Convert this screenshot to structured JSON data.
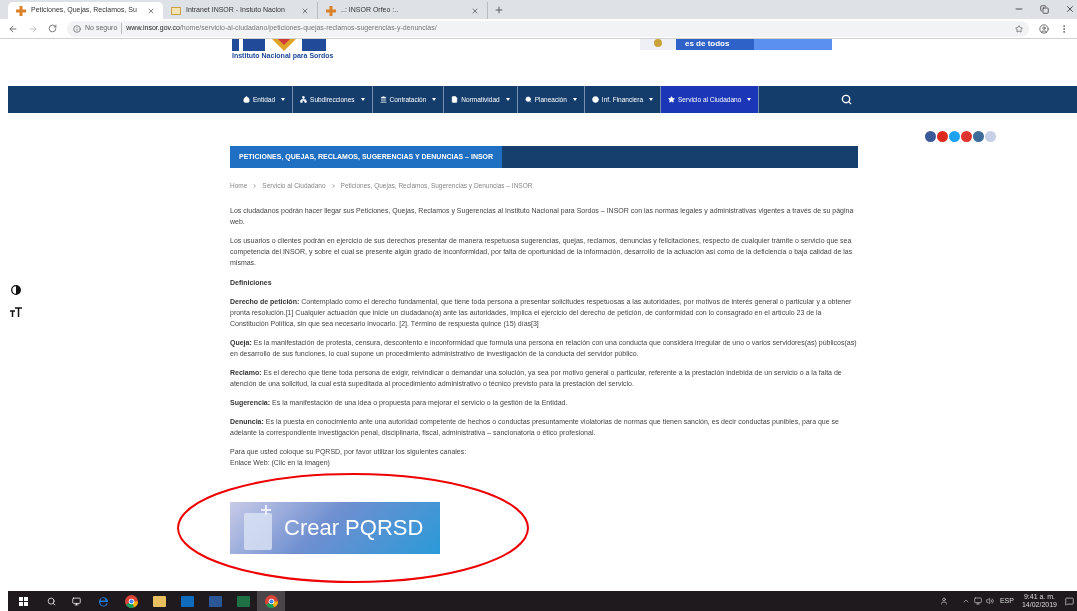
{
  "browser": {
    "tabs": [
      {
        "title": "Peticiones, Quejas, Reclamos, Su",
        "selected": true
      },
      {
        "title": "Intranet INSOR - Instuto Nacion",
        "selected": false
      },
      {
        "title": "..: INSOR Orfeo :..",
        "selected": false
      }
    ],
    "security": "No seguro",
    "url_host": "www.insor.gov.co",
    "url_path": "/home/servicio-al-ciudadano/peticiones-quejas-reclamos-sugerencias-y-denuncias/"
  },
  "header": {
    "logo_subtitle": "Instituto Nacional para Sordos",
    "banner": "es de todos"
  },
  "nav": [
    {
      "label": "Entidad",
      "selected": false
    },
    {
      "label": "Subdirecciones",
      "selected": false
    },
    {
      "label": "Contratación",
      "selected": false
    },
    {
      "label": "Normatividad",
      "selected": false
    },
    {
      "label": "Planeación",
      "selected": false
    },
    {
      "label": "Inf. Financiera",
      "selected": false
    },
    {
      "label": "Servicio al Ciudadano",
      "selected": true
    }
  ],
  "page": {
    "title": "PETICIONES, QUEJAS, RECLAMOS, SUGERENCIAS Y DENUNCIAS – INSOR",
    "breadcrumb": [
      "Home",
      "Servicio al Ciudadano",
      "Peticiones, Quejas, Reclamos, Sugerencias y Denuncias – INSOR"
    ],
    "intro": [
      "Los ciudadanos podrán hacer llegar sus Peticiones, Quejas, Reclamos y Sugerencias al Instituto Nacional para Sordos – INSOR con las normas legales y administrativas vigentes a través de su página web.",
      "Los usuarios o clientes podrán en ejercicio de sus derechos presentar de manera respetuosa sugerencias, quejas, reclamos, denuncias y felicitaciones, respecto de cualquier trámite o servicio que sea competencia del INSOR, y sobre el cual se presente algún grado de inconformidad, por falta de oportunidad de la información, desarrollo de la actuación así como de la deficiencia o baja calidad de las mismas."
    ],
    "definitions_heading": "Definiciones",
    "definitions": [
      "**Derecho de petición:** Contemplado como el derecho fundamental, que tiene toda persona a presentar solicitudes respetuosas a las autoridades, por motivos de interés general o particular y a obtener pronta resolución.[1] Cualquier actuación que inicie un ciudadano(a) ante las autoridades, implica el ejercicio del derecho de petición, de conformidad con lo consagrado en el artículo 23 de la Constitución Política, sin que sea necesario invocarlo. [2]. Término de respuesta quince (15) días[3]",
      "**Queja:** Es la manifestación de protesta, censura, descontento e inconformidad que formula una persona en relación con una conducta que considera irregular de uno o varios servidores(as) públicos(as) en desarrollo de sus funciones, lo cual supone un procedimiento administrativo de investigación de la conducta del servidor público.",
      "**Reclamo:** Es el derecho que tiene toda persona de exigir, reivindicar o demandar una solución, ya sea por motivo general o particular, referente a la prestación indebida de un servicio o a la falta de atención de una solicitud, la cual está supeditada al procedimiento administrativo o técnico previsto para la prestación del servicio.",
      "**Sugerencia:** Es la manifestación de una idea o propuesta para mejorar el servicio o la gestión de la Entidad.",
      "**Denuncia:** Es la puesta en conocimiento ante una autoridad competente de hechos o conductas presuntamente violatorias de normas que tienen sanción, es decir conductas punibles, para que se adelante la correspondiente investigación penal, disciplinaria, fiscal, administrativa – sancionatoria o ético profesional."
    ],
    "channels_lines": [
      "Para que usted coloque su PQRSD, por favor utilizar los siguientes canales:",
      "Enlace Web: (Clic en la imagen)"
    ],
    "cta": "Crear PQRSD"
  },
  "taskbar": {
    "apps": [
      {
        "kind": "edge",
        "selected": false
      },
      {
        "kind": "chrome",
        "selected": false
      },
      {
        "kind": "explorer",
        "selected": false
      },
      {
        "kind": "outlook",
        "selected": false
      },
      {
        "kind": "word",
        "selected": false
      },
      {
        "kind": "excel",
        "selected": false
      },
      {
        "kind": "chrome",
        "selected": true
      }
    ],
    "language": "ESP",
    "time": "9:41 a. m.",
    "date": "14/02/2019"
  }
}
